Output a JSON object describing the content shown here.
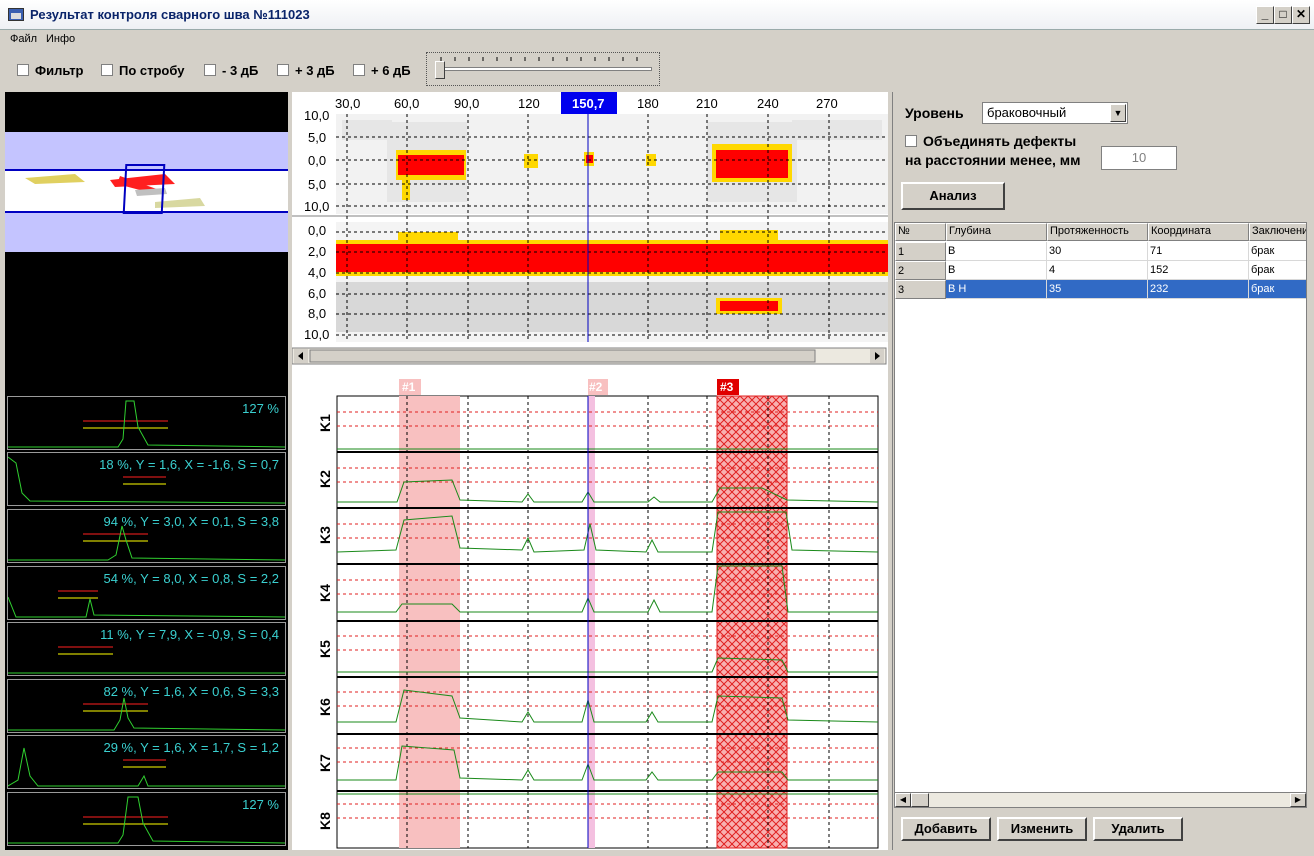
{
  "window": {
    "title": "Результат контроля сварного шва №111023"
  },
  "menu": [
    "Файл",
    "Инфо"
  ],
  "toolbar": {
    "checkboxes": [
      "Фильтр",
      "По стробу",
      "- 3 дБ",
      "+ 3 дБ",
      "+ 6 дБ"
    ]
  },
  "scan": {
    "x_ticks": [
      "30,0",
      "60,0",
      "90,0",
      "120",
      "150,7",
      "180",
      "210",
      "240",
      "270"
    ],
    "cursor_value": "150,7",
    "top_y_ticks": [
      "10,0",
      "5,0",
      "0,0",
      "5,0",
      "10,0"
    ],
    "bottom_y_ticks": [
      "0,0",
      "2,0",
      "4,0",
      "6,0",
      "8,0",
      "10,0"
    ],
    "defect_markers": [
      "#1",
      "#2",
      "#3"
    ],
    "channels": [
      "K1",
      "K2",
      "K3",
      "K4",
      "K5",
      "K6",
      "K7",
      "K8"
    ]
  },
  "mini_signals": [
    "127 %",
    "18 %, Y = 1,6, X = -1,6, S = 0,7",
    "94 %, Y = 3,0, X = 0,1, S = 3,8",
    "54 %, Y = 8,0, X = 0,8, S = 2,2",
    "11 %, Y = 7,9, X = -0,9, S = 0,4",
    "82 %, Y = 1,6, X = 0,6, S = 3,3",
    "29 %, Y = 1,6, X = 1,7, S = 1,2",
    "127 %"
  ],
  "analysis": {
    "level_label": "Уровень",
    "level_value": "браковочный",
    "merge_label": "Объединять дефекты",
    "distance_label": "на расстоянии менее, мм",
    "distance_value": "10",
    "analyze_button": "Анализ"
  },
  "table": {
    "headers": [
      "№",
      "Глубина",
      "Протяженность",
      "Координата",
      "Заключени"
    ],
    "rows": [
      [
        "1",
        "В",
        "30",
        "71",
        "брак"
      ],
      [
        "2",
        "В",
        "4",
        "152",
        "брак"
      ],
      [
        "3",
        "В Н",
        "35",
        "232",
        "брак"
      ]
    ]
  },
  "buttons": {
    "add": "Добавить",
    "edit": "Изменить",
    "delete": "Удалить"
  },
  "colors": {
    "accent": "#316ac5",
    "signal": "#1a8a1a",
    "defect": "#ff0000"
  }
}
